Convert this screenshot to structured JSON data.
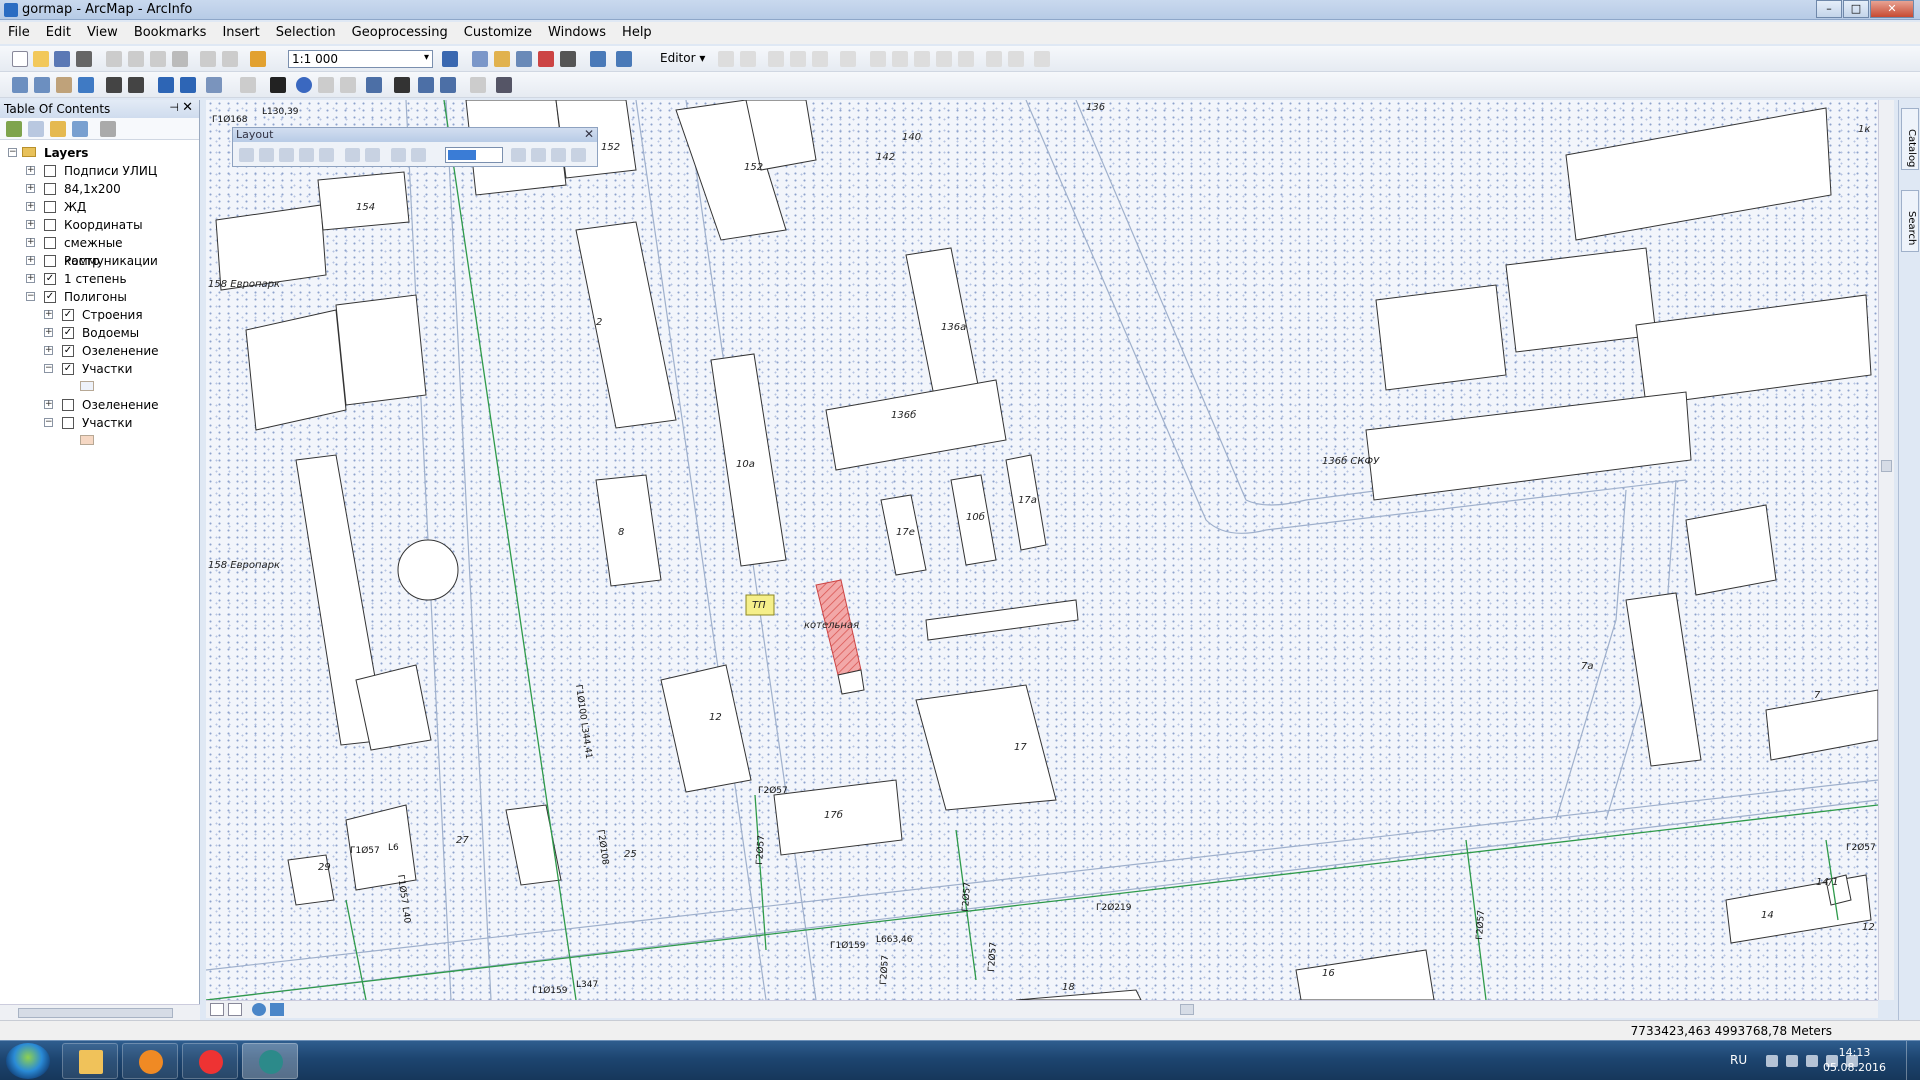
{
  "window": {
    "title": "gormap - ArcMap - ArcInfo",
    "minimize": "–",
    "maximize": "□",
    "close": "✕"
  },
  "menu": [
    "File",
    "Edit",
    "View",
    "Bookmarks",
    "Insert",
    "Selection",
    "Geoprocessing",
    "Customize",
    "Windows",
    "Help"
  ],
  "toolbar": {
    "scale": "1:1 000",
    "editor_label": "Editor ▾"
  },
  "toc": {
    "title": "Table Of Contents",
    "pin": "⊣",
    "close": "✕",
    "root": "Layers",
    "layers": [
      {
        "label": "Подписи УЛИЦ",
        "checked": false,
        "level": 0,
        "expander": "+"
      },
      {
        "label": "84,1x200",
        "checked": false,
        "level": 0,
        "expander": "+"
      },
      {
        "label": "ЖД",
        "checked": false,
        "level": 0,
        "expander": "+"
      },
      {
        "label": "Координаты",
        "checked": false,
        "level": 0,
        "expander": "+"
      },
      {
        "label": "смежные коммуникации",
        "checked": false,
        "level": 0,
        "expander": "+"
      },
      {
        "label": "Растр",
        "checked": false,
        "level": 0,
        "expander": "+"
      },
      {
        "label": "1 степень",
        "checked": true,
        "level": 0,
        "expander": "+"
      },
      {
        "label": "Полигоны",
        "checked": true,
        "level": 0,
        "expander": "−"
      },
      {
        "label": "Строения",
        "checked": true,
        "level": 1,
        "expander": "+"
      },
      {
        "label": "Водоемы",
        "checked": true,
        "level": 1,
        "expander": "+"
      },
      {
        "label": "Озеленение",
        "checked": true,
        "level": 1,
        "expander": "+"
      },
      {
        "label": "Участки",
        "checked": true,
        "level": 1,
        "expander": "−"
      },
      {
        "label": "Озеленение",
        "checked": false,
        "level": 1,
        "expander": "+"
      },
      {
        "label": "Участки",
        "checked": false,
        "level": 1,
        "expander": "−"
      }
    ],
    "swatch_colors": [
      "#eef2fa",
      "#f6d8c4"
    ]
  },
  "layout_toolbar": {
    "title": "Layout",
    "close": "✕"
  },
  "dock": {
    "catalog": "Catalog",
    "search": "Search"
  },
  "map": {
    "labels": {
      "b154": "154",
      "b152a": "152",
      "b152b": "152",
      "b142": "142",
      "b140": "140",
      "b136": "136",
      "b2": "2",
      "b136a": "136а",
      "b136b": "136б",
      "b10a": "10а",
      "b8": "8",
      "b17e": "17е",
      "b10b": "10б",
      "b17a": "17а",
      "skfu": "136б СКФУ",
      "tp": "ТП",
      "boiler": "котельная",
      "b12": "12",
      "b17": "17",
      "b17b": "17б",
      "b27": "27",
      "b29": "29",
      "b25": "25",
      "b18": "18",
      "b16": "16",
      "b14": "14",
      "b14_1": "14/1",
      "b7a": "7а",
      "b7": "7",
      "b12r": "12",
      "b1k": "1к",
      "park1": "158 Европарк",
      "park2": "158 Европарк",
      "pipe1": "Г1Ø168",
      "pipe1b": "L130,39",
      "pipe2": "Г1Ø100 L344,41",
      "pipe3": "Г2Ø108",
      "pipe4": "Г2Ø57",
      "pipe5": "Г2Ø57",
      "pipe6": "Г1Ø159",
      "pipe6b": "L663,46",
      "pipe7": "Г2Ø219",
      "pipe8": "Г1Ø159",
      "pipe8b": "L347",
      "pipe9": "Г1Ø57",
      "pipe9b": "L6",
      "pipe10": "Г1Ø57 L40",
      "pipe11": "Г2Ø57",
      "pipe12": "Г2Ø57",
      "pipe13": "Г2Ø57",
      "pipe14": "Г2Ø57",
      "pipe15": "Г2Ø57"
    }
  },
  "status": {
    "coords": "7733423,463  4993768,78 Meters"
  },
  "taskbar": {
    "lang": "RU",
    "time": "14:13",
    "date": "05.08.2016"
  },
  "colors": {
    "boiler_fill": "#f2a8a8",
    "boiler_hatch": "#d9534f",
    "tp_fill": "#f5ef8a",
    "pipe": "#2e9a4a",
    "road": "#9fb0cc"
  }
}
